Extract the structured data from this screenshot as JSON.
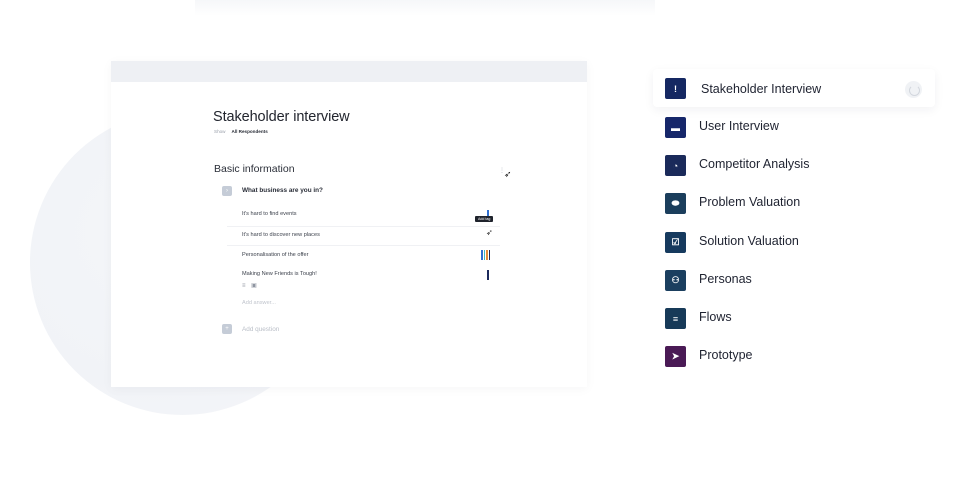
{
  "document": {
    "title": "Stakeholder interview",
    "show_label": "Show",
    "show_value": "All Respondents",
    "section_title": "Basic information",
    "question": "What business are you in?",
    "answers": [
      "It's hard to find events",
      "It's hard to discover new places",
      "Personalisation of the offer",
      "Making New Friends is Tough!"
    ],
    "tooltip": "Add tag",
    "add_answer": "Add answer...",
    "add_question": "Add question",
    "colors": {
      "tag_blue": "#2f6fd0",
      "tag_teal": "#3fb6c2",
      "tag_orange": "#e08a3a",
      "tag_navy": "#1c2a5c"
    }
  },
  "menu": {
    "items": [
      {
        "label": "Stakeholder Interview",
        "icon": "exclamation-icon",
        "color": "#152862",
        "glyph": "!"
      },
      {
        "label": "User Interview",
        "icon": "chat-icon",
        "color": "#16276a",
        "glyph": "▬"
      },
      {
        "label": "Competitor Analysis",
        "icon": "pie-chart-icon",
        "color": "#1a2a5a",
        "glyph": "◔"
      },
      {
        "label": "Problem Valuation",
        "icon": "eraser-icon",
        "color": "#1b3e5c",
        "glyph": "⬬"
      },
      {
        "label": "Solution Valuation",
        "icon": "check-box-icon",
        "color": "#163a5e",
        "glyph": "☑"
      },
      {
        "label": "Personas",
        "icon": "people-icon",
        "color": "#1b3f5f",
        "glyph": "⚇"
      },
      {
        "label": "Flows",
        "icon": "flow-icon",
        "color": "#173a58",
        "glyph": "≡"
      },
      {
        "label": "Prototype",
        "icon": "pointer-icon",
        "color": "#4a1a55",
        "glyph": "➤"
      }
    ]
  }
}
